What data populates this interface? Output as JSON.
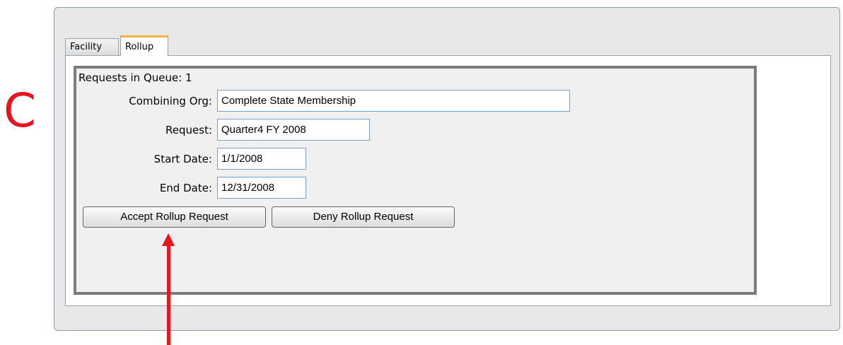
{
  "callout": {
    "letter": "C"
  },
  "tabs": [
    {
      "label": "Facility",
      "active": false
    },
    {
      "label": "Rollup",
      "active": true
    }
  ],
  "rollup": {
    "queue_text": "Requests in Queue: 1",
    "fields": {
      "combining_org": {
        "label": "Combining Org:",
        "value": "Complete State Membership"
      },
      "request": {
        "label": "Request:",
        "value": "Quarter4 FY 2008"
      },
      "start_date": {
        "label": "Start Date:",
        "value": "1/1/2008"
      },
      "end_date": {
        "label": "End Date:",
        "value": "12/31/2008"
      }
    },
    "buttons": {
      "accept": "Accept Rollup Request",
      "deny": "Deny Rollup Request"
    }
  },
  "colors": {
    "annotation_red": "#e8141e",
    "active_tab_accent": "#f5b53a",
    "input_border": "#7a9cc6"
  }
}
